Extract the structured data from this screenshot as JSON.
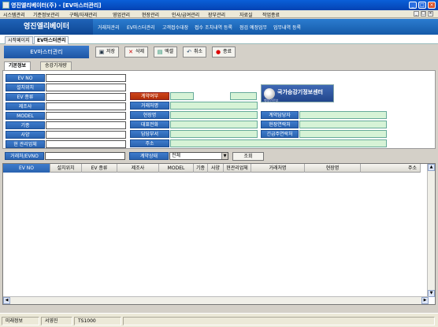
{
  "window": {
    "title": "영진엘리베이터(주) - [EV마스터관리]"
  },
  "menu": [
    "시스템관리",
    "기준정보관리",
    "구매/자재관리",
    "영업관리",
    "현장관리",
    "인사/급여관리",
    "장부관리",
    "자료실",
    "작업종료"
  ],
  "header": {
    "logo": "영진엘리베이터",
    "items": [
      "거래처관리",
      "EV마스터관리",
      "고객접수대장",
      "접수 조치내역 등록",
      "점검 예정업무",
      "업무내역 등록"
    ]
  },
  "tabs": [
    "시작페이지",
    "EV마스터관리"
  ],
  "form_title": "EV마스터관리",
  "toolbar": {
    "save": "저장",
    "delete": "삭제",
    "excel": "엑셀",
    "cancel": "취소",
    "close": "종료"
  },
  "subtabs": [
    "기본정보",
    "승강기개량"
  ],
  "fields_left": [
    "EV NO",
    "설치위치",
    "EV 종류",
    "제조사",
    "MODEL",
    "기종",
    "사양",
    "현 관리업체"
  ],
  "fields_mid": [
    "계약여부",
    "거래처명",
    "현장명",
    "대표전화",
    "담당부서",
    "주소"
  ],
  "fields_right": [
    "계약담당자",
    "현장연락처",
    "긴급주연락처"
  ],
  "gov_badge": {
    "name": "국가승강기정보센터",
    "sub": "행정안전부"
  },
  "search": {
    "label1": "거래처/EVNO",
    "label2": "계약상태",
    "select_value": "전체",
    "button": "조회"
  },
  "grid": {
    "columns": [
      "EV NO",
      "설치위치",
      "EV 종류",
      "제조사",
      "MODEL",
      "기종",
      "사양",
      "현관리업체",
      "거래처명",
      "현장명",
      "주소"
    ]
  },
  "status": [
    "미래정보",
    "서영진",
    "TS1000"
  ]
}
